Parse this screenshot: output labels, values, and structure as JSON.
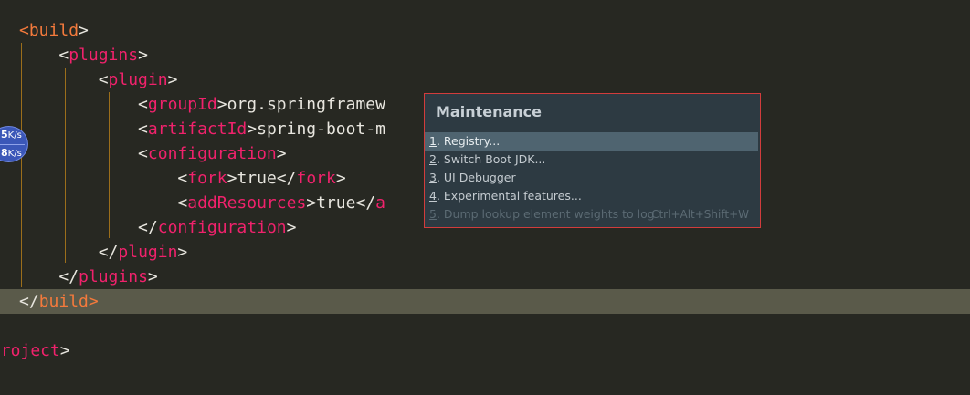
{
  "editor": {
    "lines": [
      {
        "indent": "",
        "tokens": [
          {
            "c": "br-hl",
            "t": "<"
          },
          {
            "c": "tag-hl",
            "t": "build"
          },
          {
            "c": "br",
            "t": ">"
          }
        ]
      },
      {
        "indent": "    ",
        "tokens": [
          {
            "c": "br",
            "t": "<"
          },
          {
            "c": "tag",
            "t": "plugins"
          },
          {
            "c": "br",
            "t": ">"
          }
        ]
      },
      {
        "indent": "        ",
        "tokens": [
          {
            "c": "br",
            "t": "<"
          },
          {
            "c": "tag",
            "t": "plugin"
          },
          {
            "c": "br",
            "t": ">"
          }
        ]
      },
      {
        "indent": "            ",
        "tokens": [
          {
            "c": "br",
            "t": "<"
          },
          {
            "c": "tag",
            "t": "groupId"
          },
          {
            "c": "br",
            "t": ">"
          },
          {
            "c": "text",
            "t": "org.springframew"
          }
        ]
      },
      {
        "indent": "            ",
        "tokens": [
          {
            "c": "br",
            "t": "<"
          },
          {
            "c": "tag",
            "t": "artifactId"
          },
          {
            "c": "br",
            "t": ">"
          },
          {
            "c": "text",
            "t": "spring-boot-m"
          }
        ]
      },
      {
        "indent": "            ",
        "tokens": [
          {
            "c": "br",
            "t": "<"
          },
          {
            "c": "tag",
            "t": "configuration"
          },
          {
            "c": "br",
            "t": ">"
          }
        ]
      },
      {
        "indent": "                ",
        "tokens": [
          {
            "c": "br",
            "t": "<"
          },
          {
            "c": "tag",
            "t": "fork"
          },
          {
            "c": "br",
            "t": ">"
          },
          {
            "c": "text",
            "t": "true"
          },
          {
            "c": "br",
            "t": "</"
          },
          {
            "c": "tag",
            "t": "fork"
          },
          {
            "c": "br",
            "t": ">"
          }
        ]
      },
      {
        "indent": "                ",
        "tokens": [
          {
            "c": "br",
            "t": "<"
          },
          {
            "c": "tag",
            "t": "addResources"
          },
          {
            "c": "br",
            "t": ">"
          },
          {
            "c": "text",
            "t": "true"
          },
          {
            "c": "br",
            "t": "</"
          },
          {
            "c": "tag",
            "t": "a"
          }
        ]
      },
      {
        "indent": "            ",
        "tokens": [
          {
            "c": "br",
            "t": "</"
          },
          {
            "c": "tag",
            "t": "configuration"
          },
          {
            "c": "br",
            "t": ">"
          }
        ]
      },
      {
        "indent": "        ",
        "tokens": [
          {
            "c": "br",
            "t": "</"
          },
          {
            "c": "tag",
            "t": "plugin"
          },
          {
            "c": "br",
            "t": ">"
          }
        ]
      },
      {
        "indent": "    ",
        "tokens": [
          {
            "c": "br",
            "t": "</"
          },
          {
            "c": "tag",
            "t": "plugins"
          },
          {
            "c": "br",
            "t": ">"
          }
        ]
      },
      {
        "indent": "",
        "current": true,
        "tokens": [
          {
            "c": "br",
            "t": "</"
          },
          {
            "c": "tag-hl",
            "t": "build"
          },
          {
            "c": "br-hl",
            "t": ">"
          }
        ]
      },
      {
        "indent": "",
        "tokens": []
      },
      {
        "indent": "",
        "tokens": [
          {
            "c": "tag",
            "t": "project"
          },
          {
            "c": "br",
            "t": ">"
          }
        ]
      }
    ]
  },
  "net_speed": {
    "upload_value": "5",
    "upload_unit": "K/s",
    "download_value": "8",
    "download_unit": "K/s"
  },
  "popup": {
    "title": "Maintenance",
    "items": [
      {
        "mnemonic": "1",
        "label": ". Registry...",
        "selected": true,
        "disabled": false,
        "shortcut": ""
      },
      {
        "mnemonic": "2",
        "label": ". Switch Boot JDK...",
        "selected": false,
        "disabled": false,
        "shortcut": ""
      },
      {
        "mnemonic": "3",
        "label": ". UI Debugger",
        "selected": false,
        "disabled": false,
        "shortcut": ""
      },
      {
        "mnemonic": "4",
        "label": ". Experimental features...",
        "selected": false,
        "disabled": false,
        "shortcut": ""
      },
      {
        "mnemonic": "5",
        "label": ". Dump lookup element weights to log",
        "selected": false,
        "disabled": true,
        "shortcut": "Ctrl+Alt+Shift+W"
      }
    ]
  },
  "colors": {
    "background": "#272822",
    "tag": "#f0226c",
    "tag_highlight": "#f47a3c",
    "text": "#e8e6df",
    "current_line": "#5a5a4a",
    "popup_border": "#d23c3c",
    "popup_bg": "#2d3a42"
  }
}
